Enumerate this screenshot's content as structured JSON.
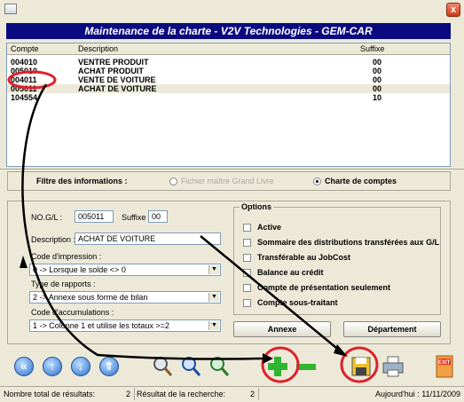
{
  "window": {
    "title": "Maintenance de la charte - V2V Technologies - GEM-CAR",
    "close_label": "x"
  },
  "table": {
    "columns": [
      "Compte",
      "Description",
      "Suffixe"
    ],
    "rows": [
      {
        "compte": "004010",
        "description": "VENTRE PRODUIT",
        "suffixe": "00"
      },
      {
        "compte": "005010",
        "description": "ACHAT PRODUIT",
        "suffixe": "00"
      },
      {
        "compte": "004011",
        "description": "VENTE DE VOITURE",
        "suffixe": "00"
      },
      {
        "compte": "005011",
        "description": "ACHAT DE VOITURE",
        "suffixe": "00"
      },
      {
        "compte": "104554",
        "description": "",
        "suffixe": "10"
      }
    ]
  },
  "filter": {
    "label": "Filtre des informations :",
    "option_grand_livre": "Fichier maître Grand Livre",
    "option_charte": "Charte de comptes",
    "selected": "charte"
  },
  "form": {
    "no_gl_label": "NO.G/L :",
    "no_gl_value": "005011",
    "suffixe_label": "Suffixe :",
    "suffixe_value": "00",
    "description_label": "Description :",
    "description_value": "ACHAT DE VOITURE",
    "code_impression_label": "Code d'impression :",
    "code_impression_value": "0 -> Lorsque le solde <> 0",
    "type_rapports_label": "Type de rapports :",
    "type_rapports_value": "2 -> Annexe sous forme de bilan",
    "code_accumulations_label": "Code d'accumulations :",
    "code_accumulations_value": "1 -> Colonne 1 et utilise les totaux >=2"
  },
  "options": {
    "title": "Options",
    "items": [
      "Active",
      "Sommaire des distributions transférées aux G/L",
      "Transférable au JobCost",
      "Balance au crédit",
      "Compte de présentation seulement",
      "Compte sous-traitant"
    ]
  },
  "buttons": {
    "annexe": "Annexe",
    "departement": "Département",
    "exit": "EXIT"
  },
  "status": {
    "total_label": "Nombre total de résultats:",
    "total_value": "2",
    "search_label": "Résultat de la recherche:",
    "search_value": "2",
    "today": "Aujourd'hui : 11/11/2009"
  },
  "colors": {
    "banner": "#0a0a80",
    "annotation": "#e0202c",
    "add": "#2fb52f"
  }
}
